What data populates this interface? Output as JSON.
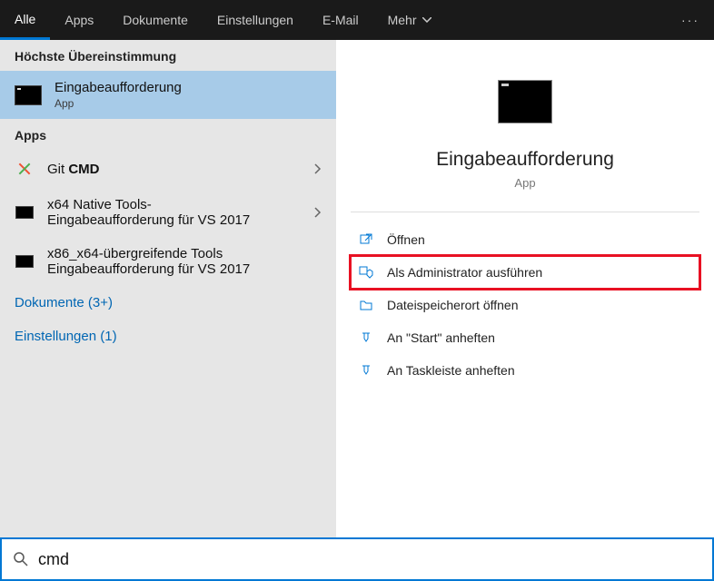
{
  "tabs": {
    "items": [
      {
        "label": "Alle"
      },
      {
        "label": "Apps"
      },
      {
        "label": "Dokumente"
      },
      {
        "label": "Einstellungen"
      },
      {
        "label": "E-Mail"
      },
      {
        "label": "Mehr"
      }
    ],
    "active_index": 0
  },
  "left": {
    "best_match_header": "Höchste Übereinstimmung",
    "best_match": {
      "title": "Eingabeaufforderung",
      "subtitle": "App"
    },
    "apps_header": "Apps",
    "apps": [
      {
        "prefix": "Git ",
        "bold": "CMD",
        "icon": "git"
      },
      {
        "line1": "x64 Native Tools-",
        "line2": "Eingabeaufforderung für VS 2017",
        "icon": "cmd"
      },
      {
        "line1": "x86_x64-übergreifende Tools",
        "line2": "Eingabeaufforderung für VS 2017",
        "icon": "cmd"
      }
    ],
    "documents_label": "Dokumente (3+)",
    "settings_label": "Einstellungen (1)"
  },
  "preview": {
    "title": "Eingabeaufforderung",
    "subtitle": "App",
    "actions": [
      {
        "label": "Öffnen",
        "icon": "open"
      },
      {
        "label": "Als Administrator ausführen",
        "icon": "admin",
        "highlight": true
      },
      {
        "label": "Dateispeicherort öffnen",
        "icon": "folder"
      },
      {
        "label": "An \"Start\" anheften",
        "icon": "pin"
      },
      {
        "label": "An Taskleiste anheften",
        "icon": "pin"
      }
    ]
  },
  "search": {
    "value": "cmd"
  }
}
